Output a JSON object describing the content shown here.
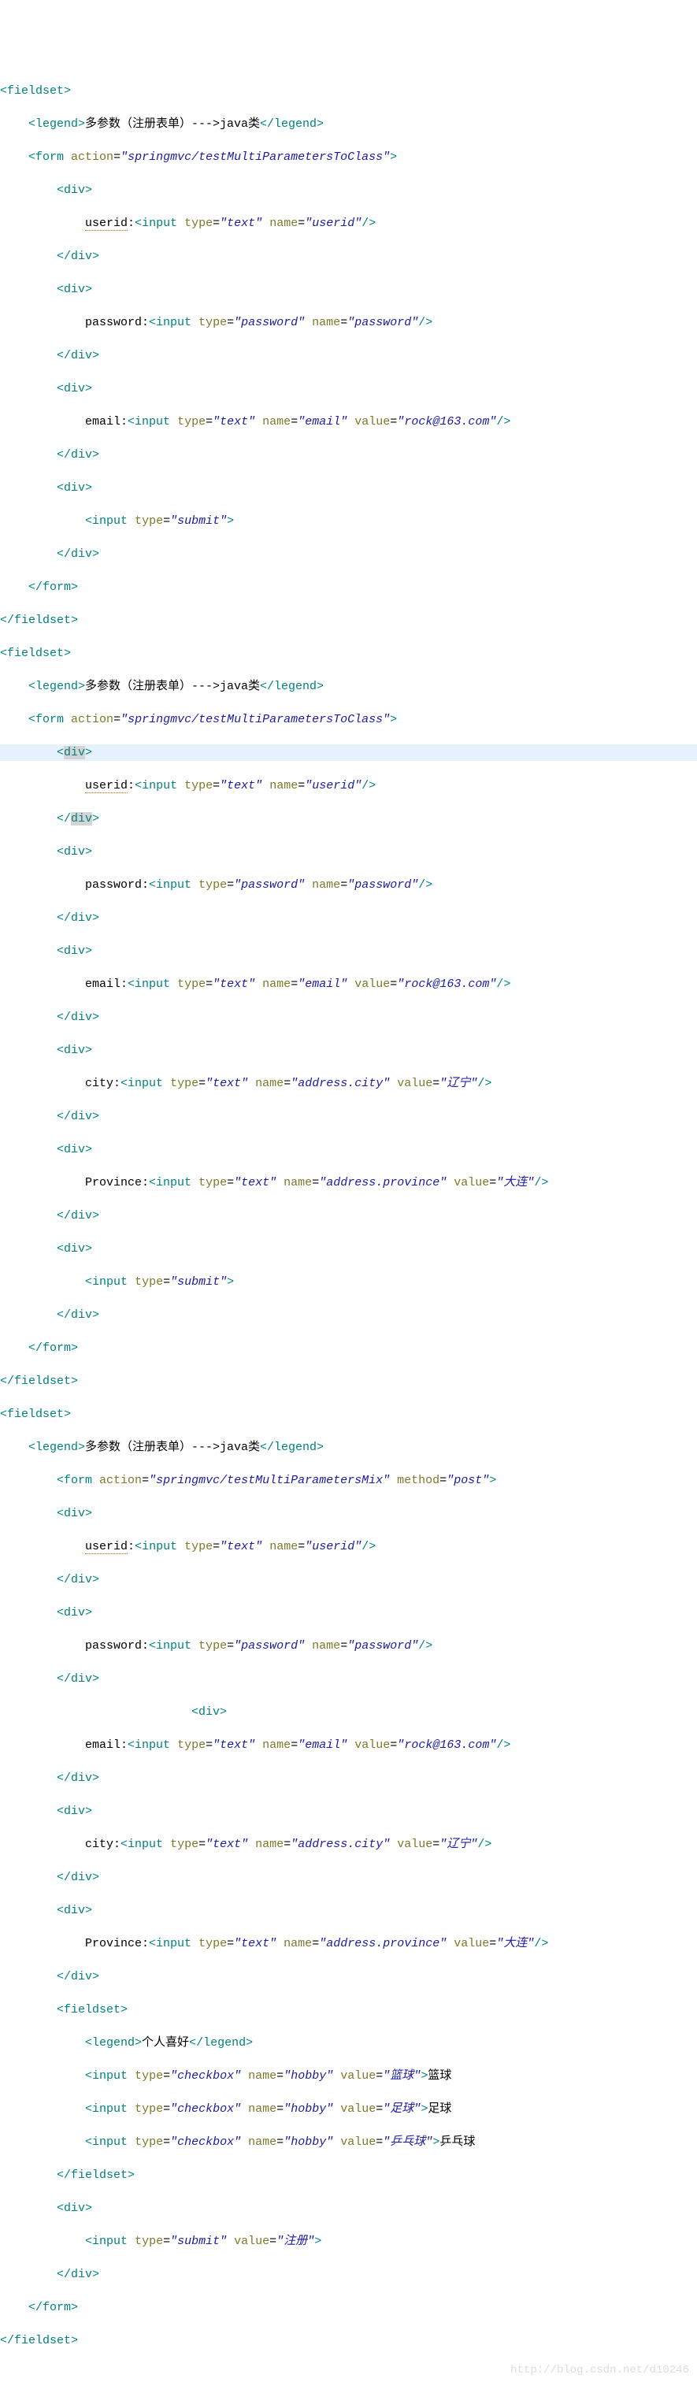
{
  "watermark": "http://blog.csdn.net/d10246",
  "tags": {
    "fieldset_open": "<fieldset>",
    "fieldset_close": "</fieldset>",
    "legend_open": "<legend>",
    "legend_close": "</legend>",
    "form_open": "<form",
    "form_close": "</form>",
    "div_open": "<div>",
    "div_close": "</div>",
    "input_open": "<input",
    "div_lt": "<",
    "div_gt": ">",
    "div_word": "div",
    "div_close_lt": "</"
  },
  "legends": {
    "l1": "多参数（注册表单）--->java类",
    "l2": "多参数（注册表单）--->java类",
    "l3": "多参数（注册表单）--->java类",
    "hobby": "个人喜好"
  },
  "forms": {
    "f1_action": "springmvc/testMultiParametersToClass",
    "f2_action": "springmvc/testMultiParametersToClass",
    "f3_action": "springmvc/testMultiParametersMix",
    "f3_method": "post"
  },
  "labels": {
    "userid": "userid",
    "password": "password:",
    "email": "email:",
    "city": "city:",
    "province": "Province:"
  },
  "attrs": {
    "action": "action",
    "type": "type",
    "name": "name",
    "value": "value",
    "method": "method"
  },
  "vals": {
    "text": "text",
    "password": "password",
    "submit": "submit",
    "checkbox": "checkbox",
    "userid": "userid",
    "pwname": "password",
    "email": "email",
    "emailval": "rock@163.com",
    "addr_city": "address.city",
    "cityval": "辽宁",
    "addr_prov": "address.province",
    "provval": "大连",
    "hobby": "hobby",
    "basketball": "篮球",
    "football": "足球",
    "pingpong": "乒乓球",
    "register": "注册"
  },
  "hobby_labels": {
    "bb": "篮球",
    "fb": "足球",
    "pp": "乒乓球"
  }
}
